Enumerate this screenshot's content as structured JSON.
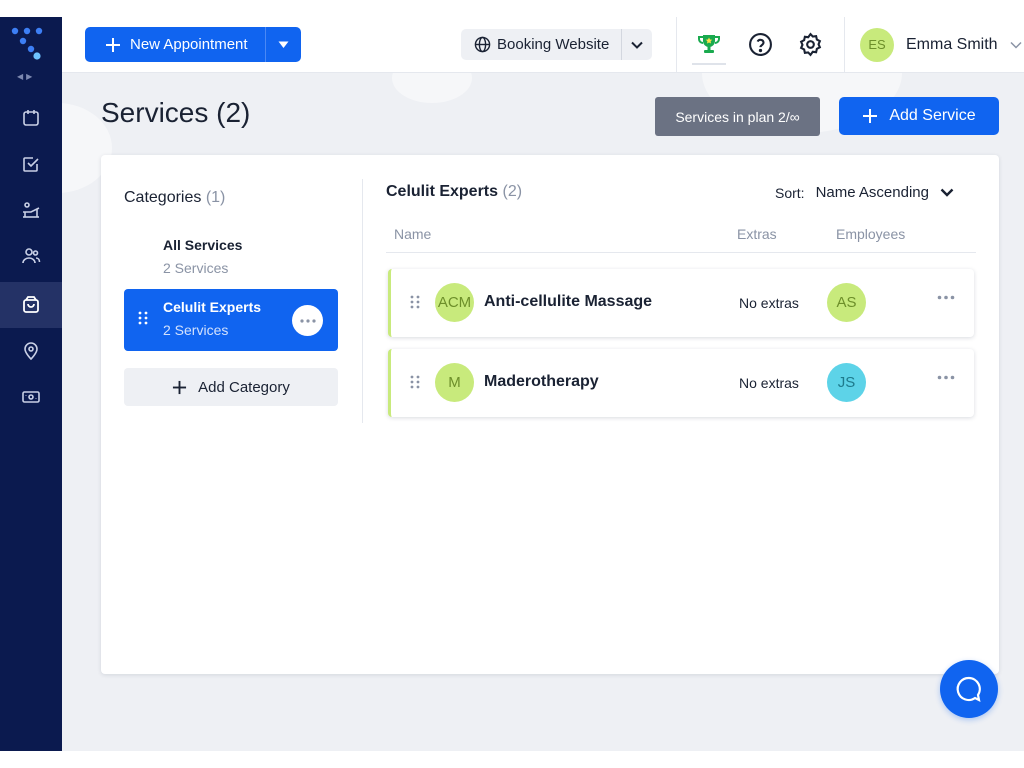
{
  "topbar": {
    "new_appointment_label": "New Appointment",
    "booking_website_label": "Booking Website",
    "user_initials": "ES",
    "user_name": "Emma Smith"
  },
  "sidebar": {
    "items": [
      {
        "icon": "calendar-icon"
      },
      {
        "icon": "check-square-icon"
      },
      {
        "icon": "bed-icon"
      },
      {
        "icon": "users-icon"
      },
      {
        "icon": "shopping-bag-icon",
        "active": true
      },
      {
        "icon": "location-pin-icon"
      },
      {
        "icon": "money-icon"
      }
    ]
  },
  "page": {
    "title": "Services (2)",
    "plan_badge": "Services in plan 2/∞",
    "add_service_label": "Add Service"
  },
  "categories": {
    "title": "Categories",
    "count": "(1)",
    "items": [
      {
        "name": "All Services",
        "count_label": "2 Services"
      },
      {
        "name": "Celulit Experts",
        "count_label": "2 Services",
        "active": true
      }
    ],
    "add_label": "Add Category"
  },
  "services": {
    "title": "Celulit Experts",
    "count": "(2)",
    "sort_label": "Sort:",
    "sort_value": "Name Ascending",
    "columns": {
      "name": "Name",
      "extras": "Extras",
      "employees": "Employees"
    },
    "rows": [
      {
        "initials": "ACM",
        "name": "Anti-cellulite Massage",
        "extras": "No extras",
        "employee": "AS",
        "employee_color": "#c8ea7c",
        "employee_text": "#6d8f2a"
      },
      {
        "initials": "M",
        "name": "Maderotherapy",
        "extras": "No extras",
        "employee": "JS",
        "employee_color": "#5dd3e8",
        "employee_text": "#1e7a8c"
      }
    ]
  },
  "colors": {
    "primary": "#1064f0",
    "sidebar": "#0b1a4f",
    "accent_green": "#c8ea7c",
    "trophy": "#1aaa4f"
  }
}
